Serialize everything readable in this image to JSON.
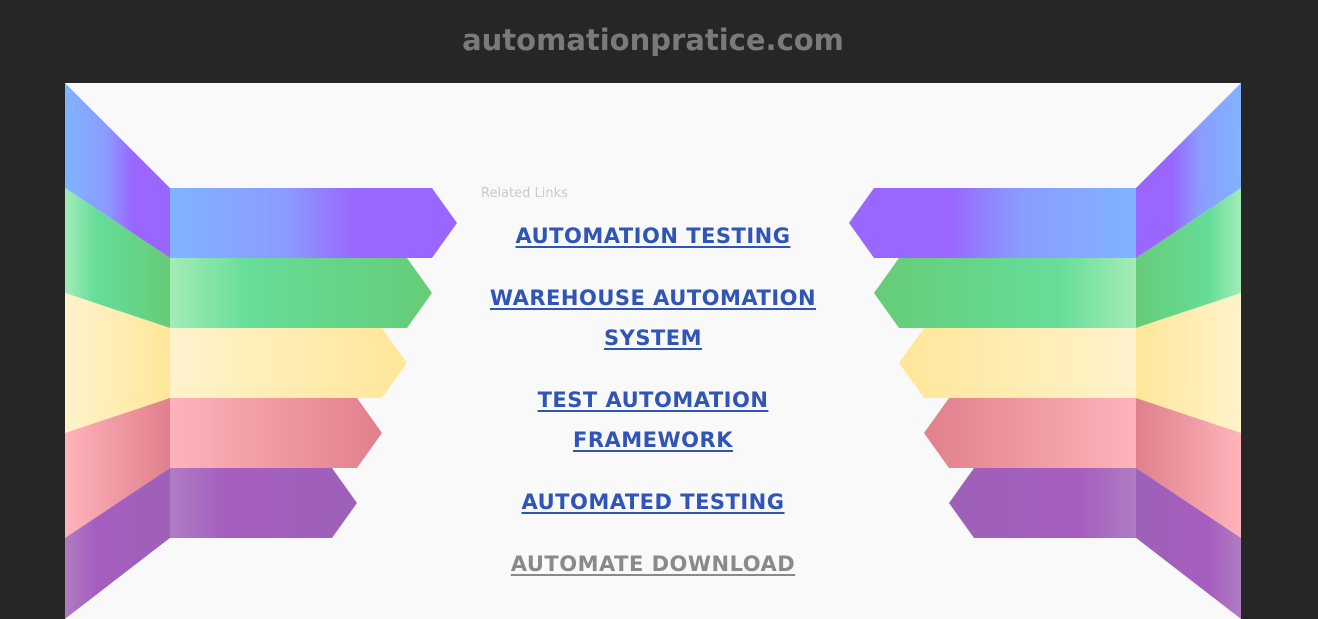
{
  "header": {
    "site_name": "automationpratice.com"
  },
  "main": {
    "related_label": "Related Links",
    "links": [
      {
        "label": "AUTOMATION TESTING",
        "state": "normal"
      },
      {
        "label": "WAREHOUSE AUTOMATION SYSTEM",
        "state": "normal"
      },
      {
        "label": "TEST AUTOMATION FRAMEWORK",
        "state": "normal"
      },
      {
        "label": "AUTOMATED TESTING",
        "state": "normal"
      },
      {
        "label": "AUTOMATE DOWNLOAD",
        "state": "visited"
      }
    ]
  },
  "colors": {
    "page_background": "#262626",
    "panel_background": "#f9f9f9",
    "link": "#2f55b8",
    "link_visited": "#8a8a8a",
    "ribbon_purple": "#9966ff",
    "ribbon_blue": "#80b3ff",
    "ribbon_green": "#66cc80",
    "ribbon_yellow": "#ffe699",
    "ribbon_pink": "#e68a96",
    "ribbon_violet": "#a066bb"
  }
}
